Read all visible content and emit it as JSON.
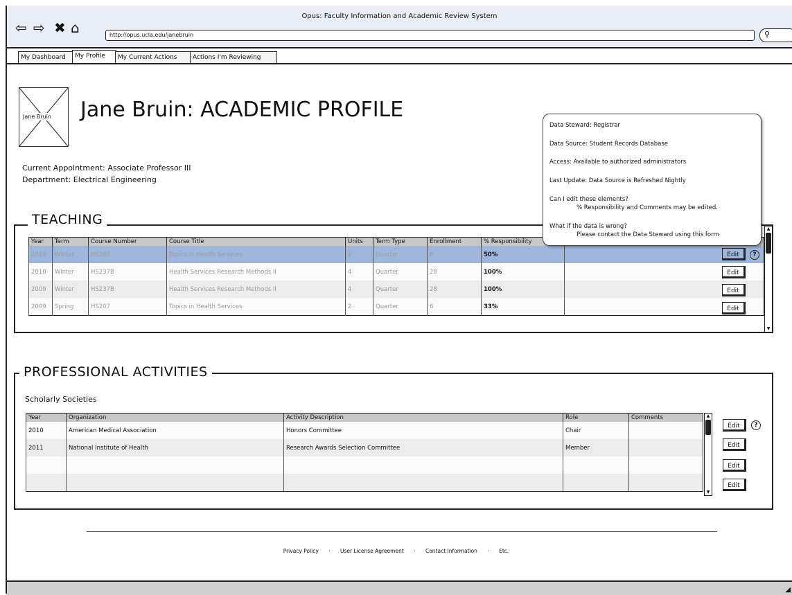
{
  "window": {
    "title": "Opus: Faculty Information and Academic Review System"
  },
  "browser": {
    "url": "http://opus.ucla.edu/janebruin"
  },
  "tabs": [
    "My Dashboard",
    "My Profile",
    "My Current Actions",
    "Actions I'm Reviewing"
  ],
  "profile": {
    "avatar_label": "Jane Bruin",
    "title": "Jane Bruin: ACADEMIC PROFILE",
    "appointment": "Current Appointment: Associate Professor III",
    "department": "Department: Electrical Engineering"
  },
  "teaching": {
    "legend": "TEACHING",
    "columns": [
      "Year",
      "Term",
      "Course Number",
      "Course Title",
      "Units",
      "Term Type",
      "Enrollment",
      "% Responsibility",
      ""
    ],
    "rows": [
      {
        "year": "2010",
        "term": "Winter",
        "number": "HS207",
        "title": "Topics in Health Services",
        "units": "2",
        "type": "Quarter",
        "enrollment": "6",
        "resp": "50%",
        "comments": ""
      },
      {
        "year": "2010",
        "term": "Winter",
        "number": "HS237B",
        "title": "Health Services Research Methods II",
        "units": "4",
        "type": "Quarter",
        "enrollment": "28",
        "resp": "100%",
        "comments": ""
      },
      {
        "year": "2009",
        "term": "Winter",
        "number": "HS237B",
        "title": "Health Services Research Methods II",
        "units": "4",
        "type": "Quarter",
        "enrollment": "28",
        "resp": "100%",
        "comments": ""
      },
      {
        "year": "2009",
        "term": "Spring",
        "number": "HS207",
        "title": "Topics in Health Services",
        "units": "2",
        "type": "Quarter",
        "enrollment": "6",
        "resp": "33%",
        "comments": ""
      }
    ],
    "edit_label": "Edit"
  },
  "tooltip": {
    "steward": "Data Steward: Registrar",
    "source": "Data Source: Student Records Database",
    "access": "Access: Available to authorized administrators",
    "update": "Last Update: Data Source is Refreshed Nightly",
    "edit_q": "Can I edit these elements?",
    "edit_a": "% Responsibility and Comments may be edited.",
    "wrong_q": "What if the data is wrong?",
    "wrong_a": "Please contact the Data Steward using this form"
  },
  "activities": {
    "legend": "PROFESSIONAL ACTIVITIES",
    "subheading": "Scholarly Societies",
    "columns": [
      "Year",
      "Organization",
      "Activity Description",
      "Role",
      "Comments"
    ],
    "rows": [
      {
        "year": "2010",
        "org": "American Medical Association",
        "desc": "Honors Committee",
        "role": "Chair",
        "comments": ""
      },
      {
        "year": "2011",
        "org": "National Institute of Health",
        "desc": "Research Awards Selection Committee",
        "role": "Member",
        "comments": ""
      },
      {
        "year": "",
        "org": "",
        "desc": "",
        "role": "",
        "comments": ""
      },
      {
        "year": "",
        "org": "",
        "desc": "",
        "role": "",
        "comments": ""
      }
    ],
    "edit_label": "Edit"
  },
  "help_glyph": "?",
  "footer": {
    "links": [
      "Privacy Policy",
      "User License Agreement",
      "Contact Information",
      "Etc."
    ],
    "separator": "·"
  }
}
